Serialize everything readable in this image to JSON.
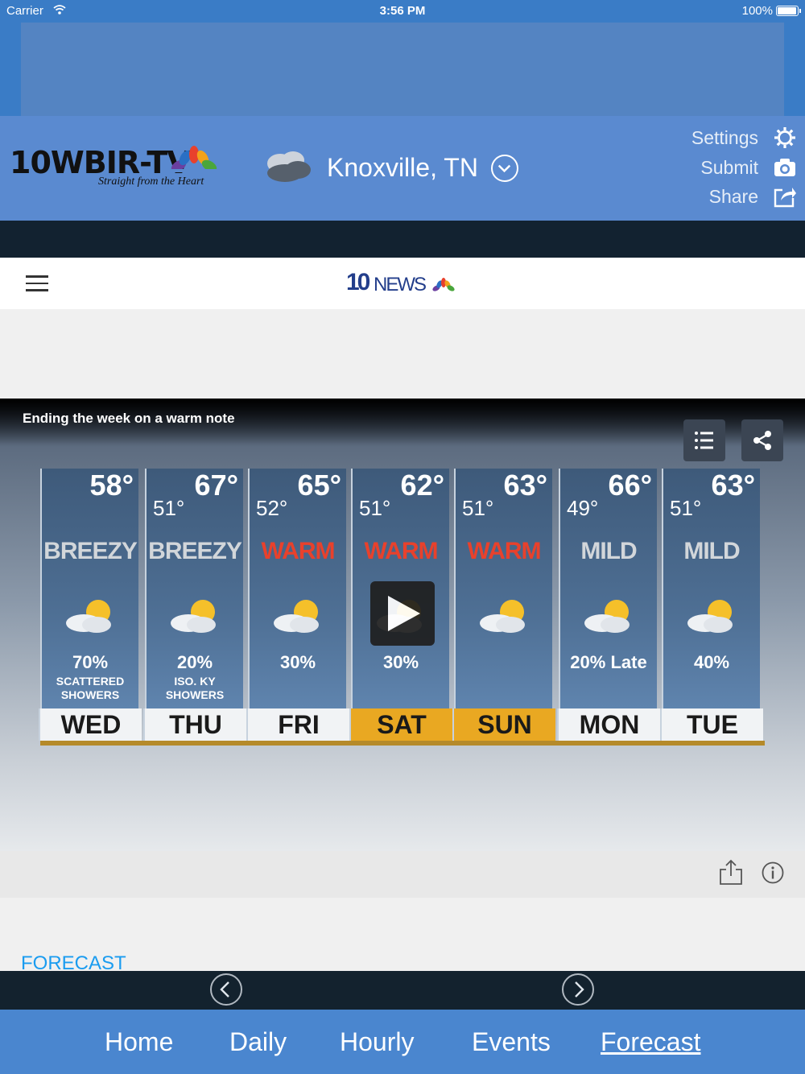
{
  "status_bar": {
    "carrier": "Carrier",
    "time": "3:56 PM",
    "battery": "100%",
    "battery_level": 1.0
  },
  "header": {
    "brand": "10WBIR-TV",
    "tagline": "Straight from the Heart",
    "weather_icon": "cloudy-icon",
    "location": "Knoxville, TN",
    "menu": [
      {
        "label": "Settings",
        "icon": "gear-icon"
      },
      {
        "label": "Submit",
        "icon": "camera-icon"
      },
      {
        "label": "Share",
        "icon": "share-icon"
      }
    ]
  },
  "site_nav": {
    "logo_number": "10",
    "logo_word": "NEWS"
  },
  "video": {
    "title": "Ending the week on a warm note",
    "days": [
      {
        "day": "WED",
        "hi": "58°",
        "lo": "",
        "cond": "BREEZY",
        "pct": "70%",
        "note": "SCATTERED SHOWERS",
        "weekend": false
      },
      {
        "day": "THU",
        "hi": "67°",
        "lo": "51°",
        "cond": "BREEZY",
        "pct": "20%",
        "note": "ISO. KY SHOWERS",
        "weekend": false
      },
      {
        "day": "FRI",
        "hi": "65°",
        "lo": "52°",
        "cond": "WARM",
        "pct": "30%",
        "note": "",
        "weekend": false
      },
      {
        "day": "SAT",
        "hi": "62°",
        "lo": "51°",
        "cond": "WARM",
        "pct": "30%",
        "note": "",
        "weekend": true
      },
      {
        "day": "SUN",
        "hi": "63°",
        "lo": "51°",
        "cond": "WARM",
        "pct": "",
        "note": "",
        "weekend": true
      },
      {
        "day": "MON",
        "hi": "66°",
        "lo": "49°",
        "cond": "MILD",
        "pct": "20% Late",
        "note": "",
        "weekend": false
      },
      {
        "day": "TUE",
        "hi": "63°",
        "lo": "51°",
        "cond": "MILD",
        "pct": "40%",
        "note": "",
        "weekend": false
      }
    ]
  },
  "forecast_heading": "FORECAST",
  "tabs": [
    "Home",
    "Daily",
    "Hourly",
    "Events",
    "Forecast"
  ],
  "active_tab": "Forecast"
}
